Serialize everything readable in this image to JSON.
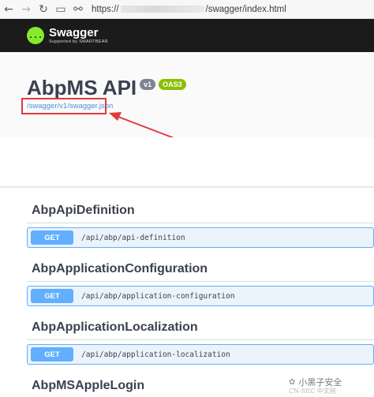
{
  "browser": {
    "url_prefix": "https://",
    "url_suffix": "/swagger/index.html"
  },
  "topbar": {
    "logo_glyph": "{...}",
    "brand": "Swagger",
    "tagline": "Supported by SMARTBEAR"
  },
  "info": {
    "title": "AbpMS API",
    "version_badge": "v1",
    "oas_badge": "OAS3",
    "spec_link": "/swagger/v1/swagger.json"
  },
  "operations": [
    {
      "tag": "AbpApiDefinition",
      "method": "GET",
      "path": "/api/abp/api-definition"
    },
    {
      "tag": "AbpApplicationConfiguration",
      "method": "GET",
      "path": "/api/abp/application-configuration"
    },
    {
      "tag": "AbpApplicationLocalization",
      "method": "GET",
      "path": "/api/abp/application-localization"
    },
    {
      "tag": "AbpMSAppleLogin"
    }
  ],
  "watermark": {
    "label": "小黑子安全",
    "footer": "CN-SEC 中文网"
  },
  "colors": {
    "topbar_bg": "#1b1b1b",
    "swagger_green": "#85ea2d",
    "get_blue": "#61affe",
    "annotation_red": "#e03a3a"
  }
}
